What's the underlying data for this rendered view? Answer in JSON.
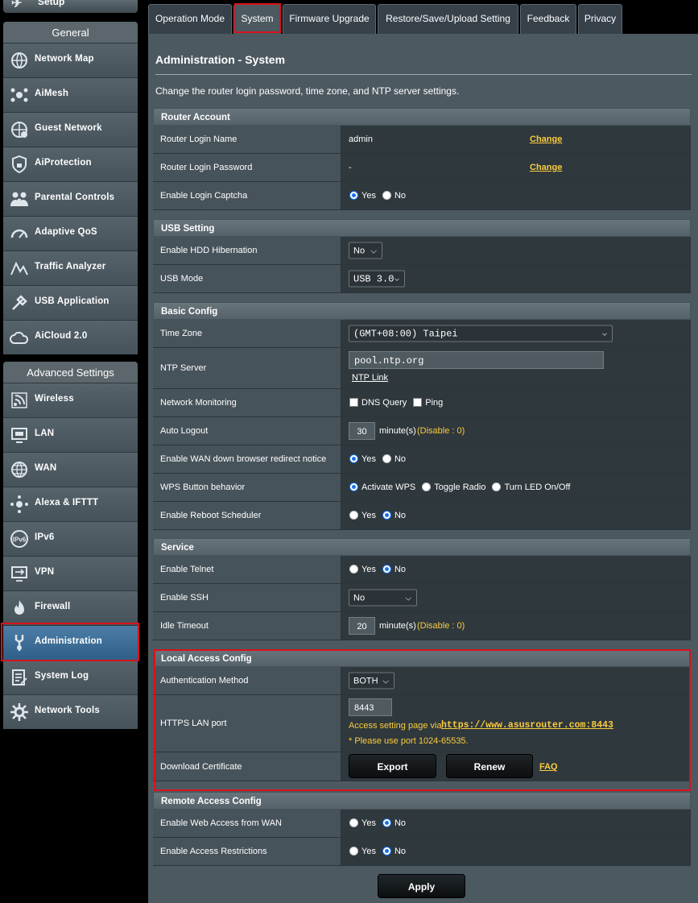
{
  "sidebar": {
    "quick_setup": "Setup",
    "general_header": "General",
    "general_items": [
      {
        "label": "Network Map",
        "icon": "network-map-icon"
      },
      {
        "label": "AiMesh",
        "icon": "aimesh-icon"
      },
      {
        "label": "Guest Network",
        "icon": "guest-network-icon"
      },
      {
        "label": "AiProtection",
        "icon": "lock-icon"
      },
      {
        "label": "Parental Controls",
        "icon": "parental-controls-icon"
      },
      {
        "label": "Adaptive QoS",
        "icon": "gauge-icon"
      },
      {
        "label": "Traffic Analyzer",
        "icon": "traffic-analyzer-icon"
      },
      {
        "label": "USB Application",
        "icon": "usb-icon"
      },
      {
        "label": "AiCloud 2.0",
        "icon": "cloud-icon"
      }
    ],
    "advanced_header": "Advanced Settings",
    "advanced_items": [
      {
        "label": "Wireless",
        "icon": "wireless-icon"
      },
      {
        "label": "LAN",
        "icon": "lan-icon"
      },
      {
        "label": "WAN",
        "icon": "globe-icon"
      },
      {
        "label": "Alexa & IFTTT",
        "icon": "alexa-icon"
      },
      {
        "label": "IPv6",
        "icon": "ipv6-icon"
      },
      {
        "label": "VPN",
        "icon": "vpn-icon"
      },
      {
        "label": "Firewall",
        "icon": "firewall-icon"
      },
      {
        "label": "Administration",
        "icon": "administration-icon"
      },
      {
        "label": "System Log",
        "icon": "system-log-icon"
      },
      {
        "label": "Network Tools",
        "icon": "network-tools-icon"
      }
    ]
  },
  "tabs": [
    "Operation Mode",
    "System",
    "Firmware Upgrade",
    "Restore/Save/Upload Setting",
    "Feedback",
    "Privacy"
  ],
  "page": {
    "title": "Administration - System",
    "description": "Change the router login password, time zone, and NTP server settings."
  },
  "router_account": {
    "header": "Router Account",
    "login_name_label": "Router Login Name",
    "login_name_value": "admin",
    "login_password_label": "Router Login Password",
    "login_password_value": "-",
    "change": "Change",
    "captcha_label": "Enable Login Captcha"
  },
  "yes": "Yes",
  "no": "No",
  "usb": {
    "header": "USB Setting",
    "hibernation_label": "Enable HDD Hibernation",
    "hibernation_value": "No",
    "mode_label": "USB Mode",
    "mode_value": "USB 3.0"
  },
  "basic": {
    "header": "Basic Config",
    "timezone_label": "Time Zone",
    "timezone_value": "(GMT+08:00) Taipei",
    "ntp_label": "NTP Server",
    "ntp_value": "pool.ntp.org",
    "ntp_link": "NTP Link",
    "monitoring_label": "Network Monitoring",
    "dns_query": "DNS Query",
    "ping": "Ping",
    "autologout_label": "Auto Logout",
    "autologout_value": "30",
    "minutes": "minute(s)",
    "disable_hint": "(Disable : 0)",
    "wan_redirect_label": "Enable WAN down browser redirect notice",
    "wps_label": "WPS Button behavior",
    "wps_activate": "Activate WPS",
    "wps_toggle": "Toggle Radio",
    "wps_led": "Turn LED On/Off",
    "reboot_label": "Enable Reboot Scheduler"
  },
  "service": {
    "header": "Service",
    "telnet_label": "Enable Telnet",
    "ssh_label": "Enable SSH",
    "ssh_value": "No",
    "idle_label": "Idle Timeout",
    "idle_value": "20"
  },
  "local_access": {
    "header": "Local Access Config",
    "auth_label": "Authentication Method",
    "auth_value": "BOTH",
    "https_label": "HTTPS LAN port",
    "https_value": "8443",
    "access_prefix": "Access setting page via",
    "access_url": "https://www.asusrouter.com:8443",
    "port_note": "* Please use port 1024-65535.",
    "cert_label": "Download Certificate",
    "export": "Export",
    "renew": "Renew",
    "faq": "FAQ"
  },
  "remote_access": {
    "header": "Remote Access Config",
    "web_access_label": "Enable Web Access from WAN",
    "restrictions_label": "Enable Access Restrictions"
  },
  "apply": "Apply"
}
